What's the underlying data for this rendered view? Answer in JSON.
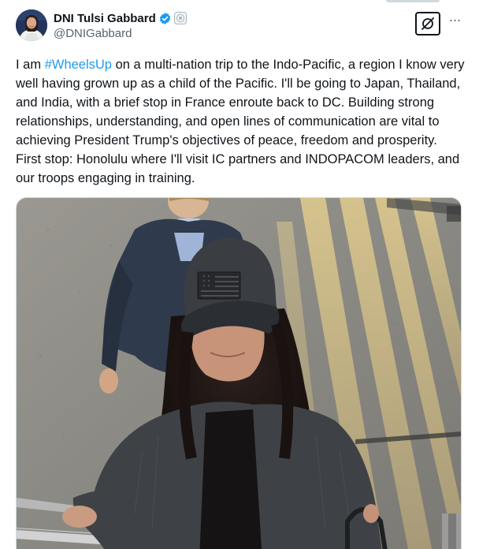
{
  "author": {
    "display_name": "DNI Tulsi Gabbard",
    "handle": "@DNIGabbard",
    "verified": true,
    "verified_color": "#1d9bf0"
  },
  "actions": {
    "grok_icon": "grok-icon",
    "more_label": "···"
  },
  "tweet": {
    "text_before_hashtag": "I am ",
    "hashtag": "#WheelsUp",
    "text_after_hashtag": " on a multi-nation trip to the Indo-Pacific, a region I know very well having grown up as a child of the Pacific. I'll be going to Japan, Thailand, and India, with a brief stop in France enroute back to DC. Building strong relationships, understanding, and open lines of communication are vital to achieving President Trump's objectives of peace, freedom and prosperity. First stop: Honolulu where I'll visit IC partners and INDOPACOM leaders, and our troops engaging in training.",
    "hashtag_color": "#1d9bf0"
  }
}
